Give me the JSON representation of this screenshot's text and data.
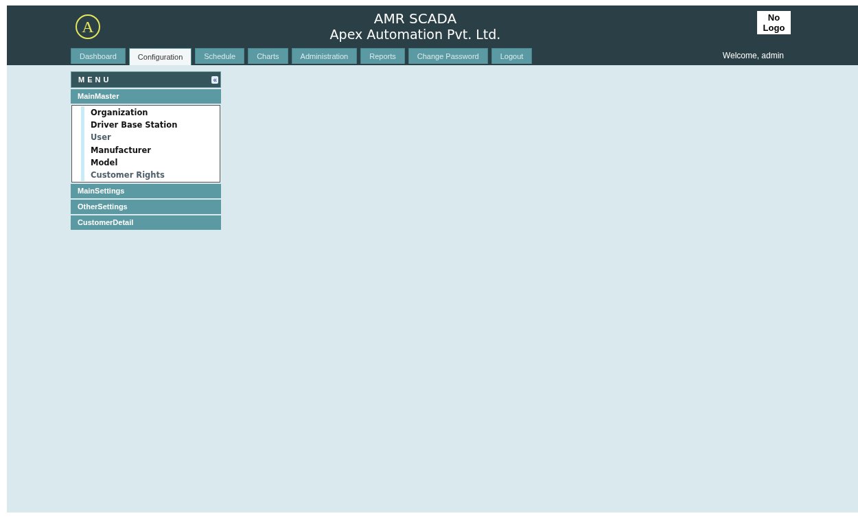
{
  "header": {
    "logo_letter": "A",
    "title": "AMR SCADA",
    "subtitle": "Apex Automation Pvt. Ltd.",
    "logo_box": [
      "No",
      "Logo"
    ],
    "welcome": "Welcome, admin"
  },
  "tabs": [
    {
      "label": "Dashboard",
      "selected": false
    },
    {
      "label": "Configuration",
      "selected": true
    },
    {
      "label": "Schedule",
      "selected": false
    },
    {
      "label": "Charts",
      "selected": false
    },
    {
      "label": "Administration",
      "selected": false
    },
    {
      "label": "Reports",
      "selected": false
    },
    {
      "label": "Change Password",
      "selected": false
    },
    {
      "label": "Logout",
      "selected": false
    }
  ],
  "menu": {
    "title": "MENU",
    "collapse_icon": "«",
    "sections": [
      {
        "label": "MainMaster",
        "items": [
          {
            "label": "Organization",
            "visited": false
          },
          {
            "label": "Driver Base Station",
            "visited": false
          },
          {
            "label": "User",
            "visited": true
          },
          {
            "label": "Manufacturer",
            "visited": false
          },
          {
            "label": "Model",
            "visited": false
          },
          {
            "label": "Customer Rights",
            "visited": true
          }
        ]
      },
      {
        "label": "MainSettings"
      },
      {
        "label": "OtherSettings"
      },
      {
        "label": "CustomerDetail"
      }
    ]
  }
}
